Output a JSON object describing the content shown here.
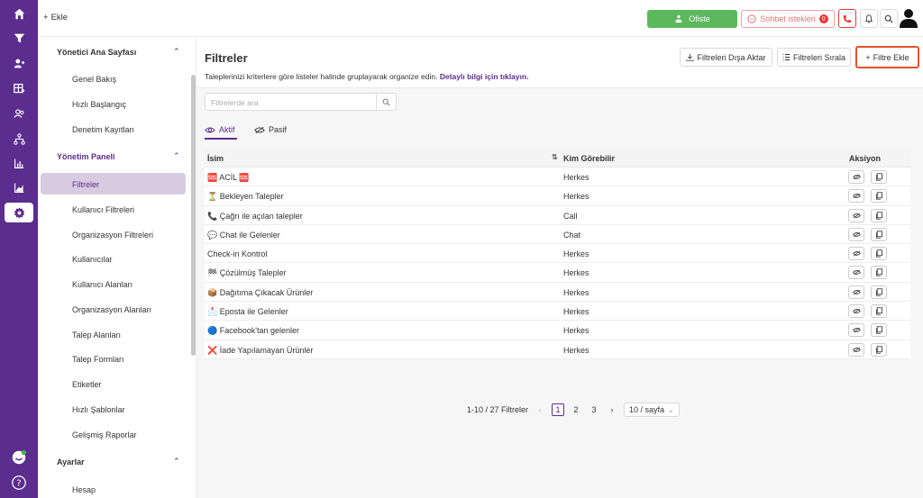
{
  "rail": {
    "icons": [
      "home-icon",
      "filter-icon",
      "users-icon",
      "table-icon",
      "contacts-icon",
      "hierarchy-icon",
      "chart-icon",
      "bar-chart-icon",
      "settings-icon"
    ]
  },
  "topbar": {
    "add_label": "Ekle",
    "ofiste_label": "Ofiste",
    "chat_requests_label": "Sohbet istekleri",
    "chat_requests_count": "0"
  },
  "sidebar": {
    "section1": "Yönetici Ana Sayfası",
    "section1_items": [
      "Genel Bakış",
      "Hızlı Başlangıç",
      "Denetim Kayıtları"
    ],
    "section2": "Yönetim Paneli",
    "section2_items": [
      "Filtreler",
      "Kullanıcı Filtreleri",
      "Organizasyon Filtreleri",
      "Kullanıcılar",
      "Kullanıcı Alanları",
      "Organizasyon Alanları",
      "Talep Alanları",
      "Talep Formları",
      "Etiketler",
      "Hızlı Şablonlar",
      "Gelişmiş Raporlar"
    ],
    "section3": "Ayarlar",
    "section3_items": [
      "Hesap"
    ]
  },
  "header": {
    "title": "Filtreler",
    "description": "Taleplerinizi kriterlere göre listeler halinde gruplayarak organize edin.",
    "link": "Detaylı bilgi için tıklayın.",
    "export_label": "Filtreleri Dışa Aktar",
    "sort_label": "Filtreleri Sırala",
    "add_label": "Filtre Ekle"
  },
  "search": {
    "placeholder": "Filtrelerde ara"
  },
  "tabs": {
    "active": "Aktif",
    "passive": "Pasif"
  },
  "table": {
    "columns": [
      "İsim",
      "Kim Görebilir",
      "Aksiyon"
    ],
    "rows": [
      {
        "name": "🆘 ACİL 🆘",
        "visibility": "Herkes"
      },
      {
        "name": "⏳ Bekleyen Talepler",
        "visibility": "Herkes"
      },
      {
        "name": "📞 Çağrı ile açılan talepler",
        "visibility": "Call"
      },
      {
        "name": "💬 Chat ile Gelenler",
        "visibility": "Chat"
      },
      {
        "name": "Check-in Kontrol",
        "visibility": "Herkes"
      },
      {
        "name": "🏁 Çözülmüş Talepler",
        "visibility": "Herkes"
      },
      {
        "name": "📦 Dağıtıma Çıkacak Ürünler",
        "visibility": "Herkes"
      },
      {
        "name": "📩 Eposta ile Gelenler",
        "visibility": "Herkes"
      },
      {
        "name": "🔵 Facebook'tan gelenler",
        "visibility": "Herkes"
      },
      {
        "name": "❌ İade Yapılamayan Ürünler",
        "visibility": "Herkes"
      }
    ]
  },
  "pagination": {
    "summary": "1-10 / 27 Filtreler",
    "pages": [
      "1",
      "2",
      "3"
    ],
    "page_size": "10 / sayfa"
  },
  "colors": {
    "brand": "#5b2d8e",
    "ofiste": "#5cb85c",
    "highlight": "#e0552d"
  }
}
